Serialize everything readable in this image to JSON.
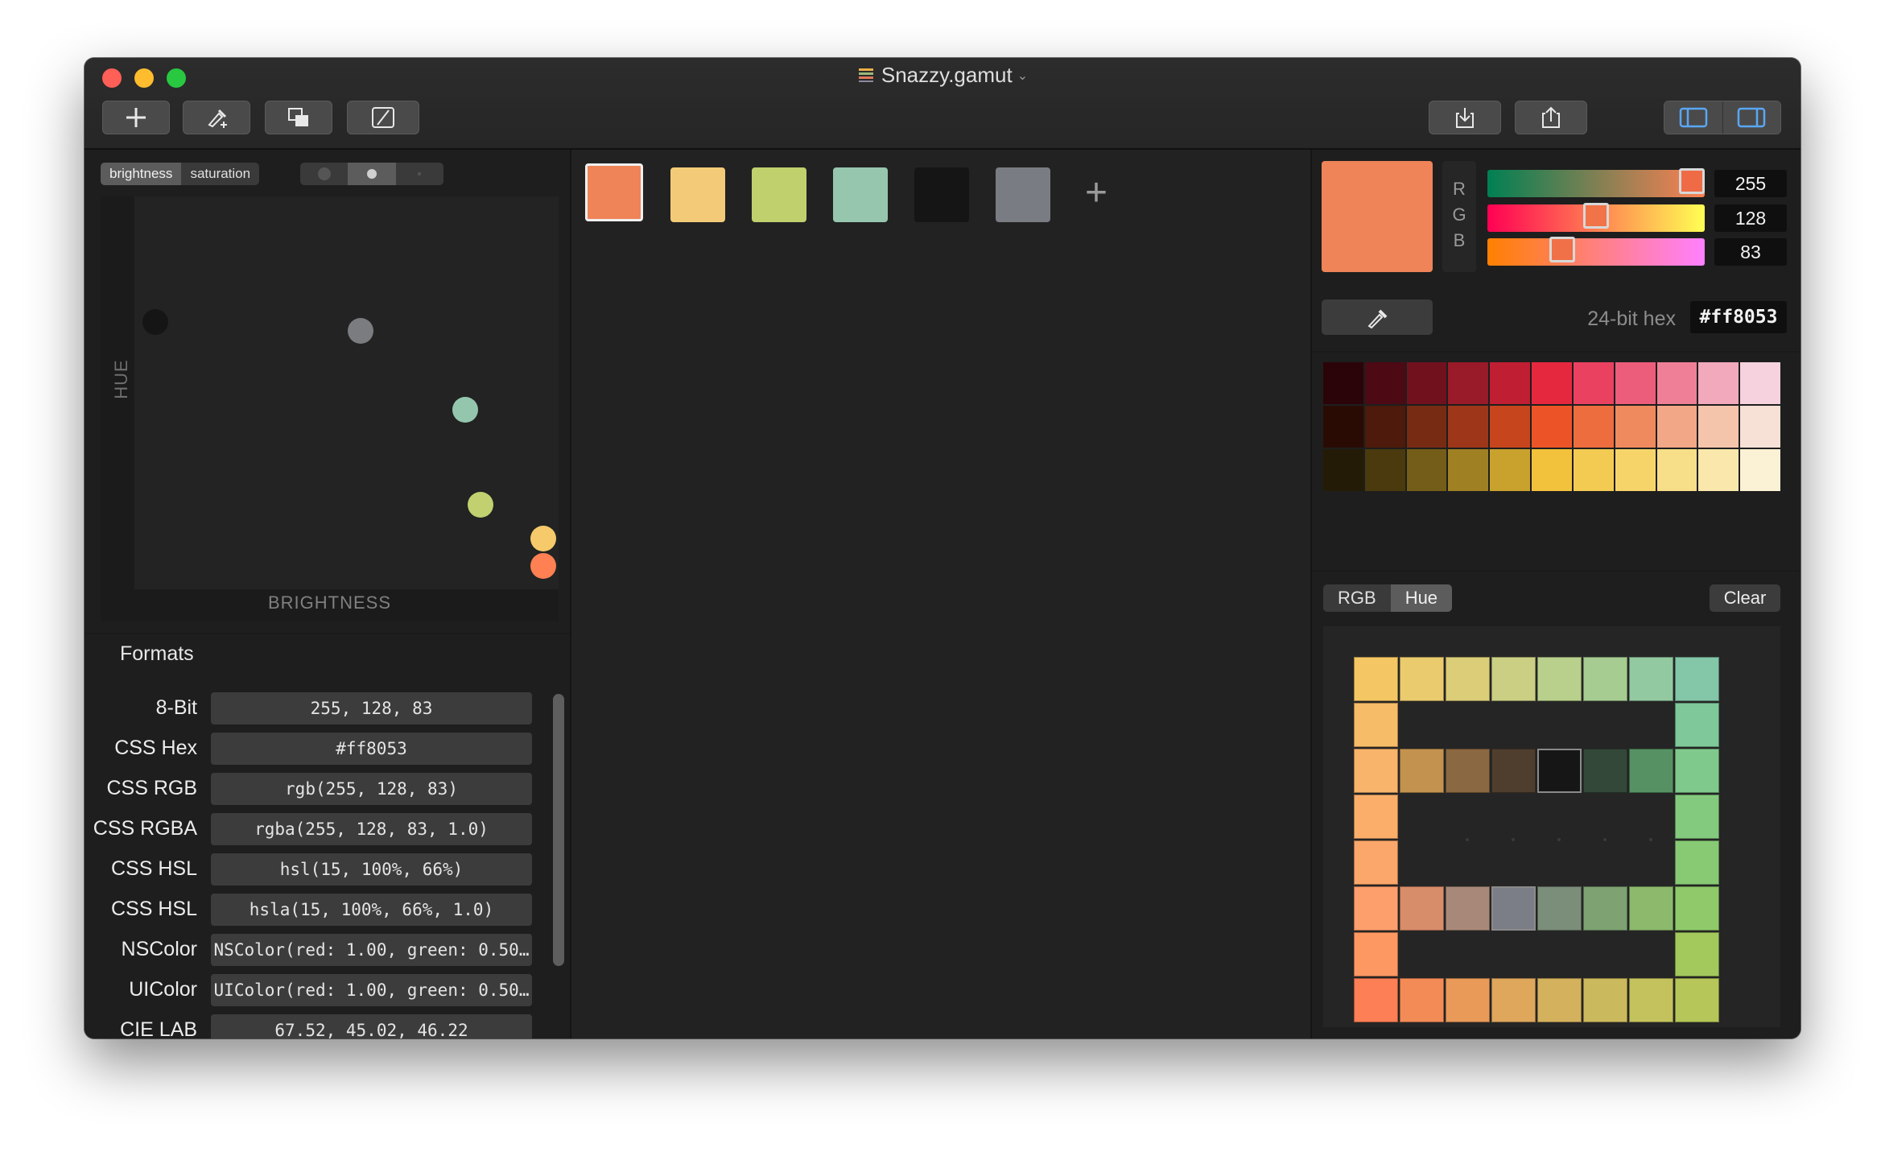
{
  "window": {
    "title": "Snazzy.gamut",
    "title_caret": "⌄"
  },
  "toolbar": {
    "left_buttons": [
      "add-icon",
      "eyedropper-add-icon",
      "duplicate-icon",
      "edit-icon"
    ],
    "right_buttons": [
      "import-icon",
      "export-icon"
    ],
    "panel_toggles": [
      "left-sidebar-icon",
      "right-sidebar-icon"
    ]
  },
  "plot": {
    "tabs": [
      "brightness",
      "saturation"
    ],
    "selected_tab": "brightness",
    "dot_size_options": [
      "large-dot-icon",
      "medium-dot-icon",
      "small-dot-icon"
    ],
    "selected_dot_size": "medium-dot-icon",
    "y_label": "HUE",
    "x_label": "BRIGHTNESS",
    "points": [
      {
        "color": "#151515"
      },
      {
        "color": "#7b7c80"
      },
      {
        "color": "#94c6ae"
      },
      {
        "color": "#c2d06f"
      },
      {
        "color": "#f6c96b"
      },
      {
        "color": "#ff8053"
      }
    ]
  },
  "formats": {
    "heading": "Formats",
    "rows": [
      {
        "label": "8-Bit",
        "value": "255, 128, 83"
      },
      {
        "label": "CSS Hex",
        "value": "#ff8053"
      },
      {
        "label": "CSS RGB",
        "value": "rgb(255, 128, 83)"
      },
      {
        "label": "CSS RGBA",
        "value": "rgba(255, 128, 83, 1.0)"
      },
      {
        "label": "CSS HSL",
        "value": "hsl(15, 100%, 66%)"
      },
      {
        "label": "CSS HSL",
        "value": "hsla(15, 100%, 66%, 1.0)"
      },
      {
        "label": "NSColor",
        "value": "NSColor(red: 1.00, green: 0.50…"
      },
      {
        "label": "UIColor",
        "value": "UIColor(red: 1.00, green: 0.50…"
      },
      {
        "label": "CIE LAB",
        "value": "67.52, 45.02, 46.22"
      }
    ]
  },
  "swatches": {
    "colors": [
      "#ef8458",
      "#f3cb78",
      "#bfd06d",
      "#97c6ae",
      "#151515",
      "#7a7c84"
    ],
    "selected_index": 0,
    "add_label": "+"
  },
  "editor": {
    "current_color": "#ef8458",
    "channel_labels": [
      "R",
      "G",
      "B"
    ],
    "channel_values": [
      "255",
      "128",
      "83"
    ],
    "hex_label": "24-bit hex",
    "hex_value": "#ff8053"
  },
  "palette": {
    "rows": [
      [
        "#2a0408",
        "#4d0a14",
        "#72111e",
        "#991a29",
        "#c01e32",
        "#e6283f",
        "#ea4161",
        "#ec5c7b",
        "#ef7f97",
        "#f1a9bb",
        "#f5d2dd"
      ],
      [
        "#2a0b04",
        "#4e1a0b",
        "#772b13",
        "#9e3719",
        "#c7451d",
        "#ec5428",
        "#ed6d3e",
        "#ef8a5e",
        "#f2a786",
        "#f4c4ab",
        "#f7e0d5"
      ],
      [
        "#231b06",
        "#4a3a0e",
        "#745d18",
        "#9f8023",
        "#c9a22e",
        "#f3c23c",
        "#f4cb52",
        "#f6d46a",
        "#f7de89",
        "#f9e7ab",
        "#fbf1d5"
      ]
    ]
  },
  "sorting": {
    "tabs": [
      "RGB",
      "Hue"
    ],
    "selected_tab": "Hue",
    "clear_label": "Clear"
  },
  "gamut_grid": {
    "outer_ring": {
      "top": [
        "#f4c764",
        "#eacb6e",
        "#dccd79",
        "#cbcf84",
        "#b8d08b",
        "#a6cc92",
        "#93c9a0",
        "#83c6a8"
      ],
      "right": [
        "#7ec89a",
        "#80c98c",
        "#84ca7e",
        "#88ca74",
        "#90c96a",
        "#a3c95d"
      ],
      "left": [
        "#f7bc68",
        "#f8b46a",
        "#faae6a",
        "#fba76b",
        "#fc9f6c",
        "#fd9863"
      ],
      "bottom": [
        "#fd7f55",
        "#f38b57",
        "#e99a59",
        "#dea75c",
        "#d4b15d",
        "#cbb95d",
        "#c3c25d",
        "#b6c659"
      ]
    },
    "inner_row_1": [
      "#c4924f",
      "#8a6841",
      "#4f3e2e",
      "#161616",
      "#34483a",
      "#569163"
    ],
    "inner_row_2": [
      "#d88d6a",
      "#a88979",
      "#7b7e86",
      "#7b8e7a",
      "#7ea272",
      "#8cb96c"
    ],
    "highlight_colors": [
      "#161616",
      "#7b7e86"
    ]
  }
}
